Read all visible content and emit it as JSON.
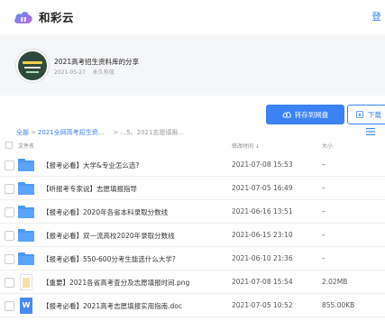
{
  "header": {
    "brand": "和彩云",
    "login": "登"
  },
  "share": {
    "title": "2021高考招生资料库的分享",
    "date": "2021-05-27",
    "validity": "永久有效"
  },
  "actions": {
    "save": "转存到网盘",
    "download": "下载"
  },
  "breadcrumb": {
    "root": "全部",
    "parent": "2021全网高考招生资...",
    "sep1": ">",
    "sep2": ">",
    "ellipsis": "...",
    "current": "5、2021志愿填报..."
  },
  "table": {
    "col_name": "文件名",
    "col_time": "修改时间 ↓",
    "col_size": "大小",
    "rows": [
      {
        "name": "【报考必看】大学&专业怎么选?",
        "time": "2021-07-08 15:53",
        "size": "–",
        "type": "folder"
      },
      {
        "name": "【听报考专家说】志愿填报指导",
        "time": "2021-07-05 16:49",
        "size": "–",
        "type": "folder"
      },
      {
        "name": "【报考必看】2020年各省本科录取分数线",
        "time": "2021-06-16 13:51",
        "size": "–",
        "type": "folder"
      },
      {
        "name": "【报考必看】双一流高校2020年录取分数线",
        "time": "2021-06-15 23:10",
        "size": "–",
        "type": "folder"
      },
      {
        "name": "【报考必看】550-600分考生能选什么大学?",
        "time": "2021-06-10 21:36",
        "size": "–",
        "type": "folder"
      },
      {
        "name": "【重要】2021各省高考查分及志愿填报时间.png",
        "time": "2021-07-08 15:54",
        "size": "2.02MB",
        "type": "image"
      },
      {
        "name": "【报考必看】2021高考志愿填报实用指南.doc",
        "time": "2021-07-05 10:52",
        "size": "855.00KB",
        "type": "doc"
      }
    ]
  },
  "icons": {
    "doc_letter": "W"
  },
  "colors": {
    "accent": "#3b82f6",
    "folder": "#4d98f5",
    "brand_gradient_start": "#6a7cf0",
    "brand_gradient_end": "#b06ad9"
  }
}
